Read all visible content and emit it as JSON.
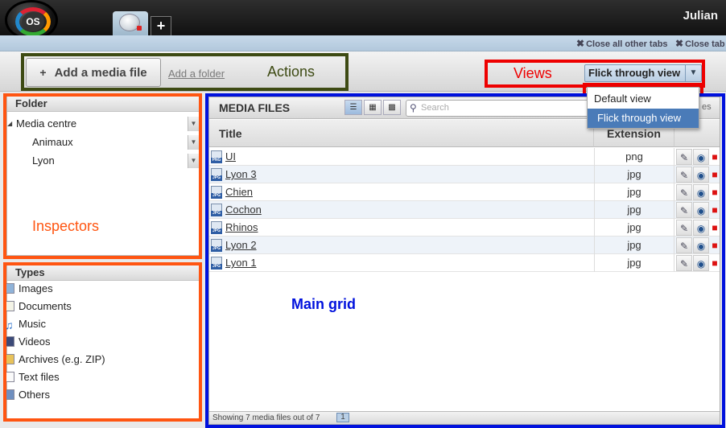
{
  "header": {
    "logo_text": "OS",
    "add_tab_label": "+",
    "username": "Julian"
  },
  "tabs_bar": {
    "close_all_other": "Close all other tabs",
    "close_tab": "Close tab"
  },
  "actions": {
    "add_media_file": "Add a media file",
    "add_media_icon": "+",
    "add_folder": "Add a folder"
  },
  "views": {
    "selected": "Flick through view",
    "options": [
      "Default view",
      "Flick through view"
    ]
  },
  "annotations": {
    "actions": "Actions",
    "views": "Views",
    "inspectors": "Inspectors",
    "main_grid": "Main grid",
    "colors": {
      "actions": "#3d4a13",
      "views": "#ee0000",
      "inspectors": "#ff5511",
      "main_grid": "#0011dd"
    }
  },
  "folder_panel": {
    "title": "Folder",
    "items": [
      "Media centre",
      "Animaux",
      "Lyon"
    ]
  },
  "types_panel": {
    "title": "Types",
    "items": [
      {
        "label": "Images",
        "icon": "image-icon"
      },
      {
        "label": "Documents",
        "icon": "document-icon"
      },
      {
        "label": "Music",
        "icon": "music-icon"
      },
      {
        "label": "Videos",
        "icon": "video-icon"
      },
      {
        "label": "Archives (e.g. ZIP)",
        "icon": "archive-icon"
      },
      {
        "label": "Text files",
        "icon": "text-file-icon"
      },
      {
        "label": "Others",
        "icon": "others-icon"
      }
    ]
  },
  "grid": {
    "title": "MEDIA FILES",
    "search_placeholder": "Search",
    "search_trailing": "es",
    "columns": {
      "title": "Title",
      "extension": "Extension"
    },
    "rows": [
      {
        "title": "UI",
        "ext": "png",
        "icon": "PNG"
      },
      {
        "title": "Lyon 3",
        "ext": "jpg",
        "icon": "JPG"
      },
      {
        "title": "Chien",
        "ext": "jpg",
        "icon": "JPG"
      },
      {
        "title": "Cochon",
        "ext": "jpg",
        "icon": "JPG"
      },
      {
        "title": "Rhinos",
        "ext": "jpg",
        "icon": "JPG"
      },
      {
        "title": "Lyon 2",
        "ext": "jpg",
        "icon": "JPG"
      },
      {
        "title": "Lyon 1",
        "ext": "jpg",
        "icon": "JPG"
      }
    ],
    "footer": "Showing 7 media files out of 7",
    "page": "1"
  }
}
